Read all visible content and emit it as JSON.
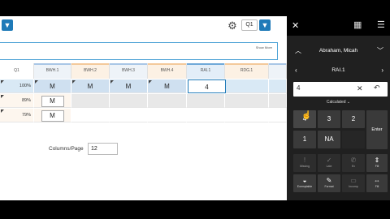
{
  "toolbar": {
    "quarter": "Q1",
    "show_more": "Show More"
  },
  "grid": {
    "columns": [
      "Q1",
      "BWH.1",
      "BWH.2",
      "BWH.3",
      "BWH.4",
      "RAI.1",
      "RDG.1"
    ],
    "rows": [
      {
        "percent": "100%",
        "scores": [
          "M",
          "M",
          "M",
          "M",
          "4",
          "",
          ""
        ]
      },
      {
        "percent": "89%",
        "scores": [
          "M",
          "",
          "",
          "",
          "",
          "",
          ""
        ]
      },
      {
        "percent": "79%",
        "scores": [
          "M",
          "",
          "",
          "",
          "",
          "",
          ""
        ]
      }
    ]
  },
  "columns_per_page": {
    "label": "Columns/Page",
    "value": "12"
  },
  "keypad": {
    "student_name": "Abraham, Micah",
    "assignment": "RAI.1",
    "entry_value": "4",
    "calc_label": "Calculated",
    "keys": {
      "k4": "4",
      "k3": "3",
      "k2": "2",
      "k1": "1",
      "kna": "NA",
      "enter": "Enter"
    },
    "flags": [
      "Missing",
      "Late",
      "Ex",
      "Fill",
      "Exemptable",
      "Format",
      "Incomp",
      "Fill"
    ]
  },
  "colors": {
    "accent": "#1f7ab8",
    "row_selected": "#d9e9f5",
    "panel_dark": "#202020"
  }
}
